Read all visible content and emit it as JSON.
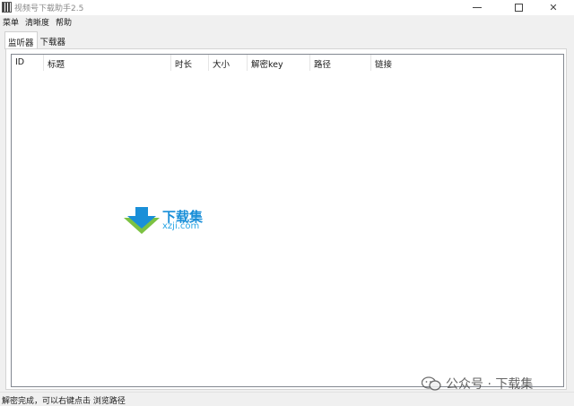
{
  "window": {
    "title": "视频号下载助手2.5",
    "min_glyph": "",
    "max_glyph": "",
    "close_glyph": "✕"
  },
  "menu": [
    {
      "label": "菜单"
    },
    {
      "label": "清晰度"
    },
    {
      "label": "帮助"
    }
  ],
  "tabs": [
    {
      "label": "监听器",
      "active": true
    },
    {
      "label": "下载器",
      "active": false
    }
  ],
  "table": {
    "columns": [
      "ID",
      "标题",
      "时长",
      "大小",
      "解密key",
      "路径",
      "链接"
    ],
    "rows": []
  },
  "watermark_logo": {
    "name": "下载集",
    "domain": "xzji.com"
  },
  "status": {
    "text": "解密完成，可以右键点击 浏览路径"
  },
  "wechat_watermark": {
    "text": "公众号 · 下载集"
  },
  "colors": {
    "logo_blue": "#1a8fd8",
    "logo_green": "#7cc242"
  }
}
